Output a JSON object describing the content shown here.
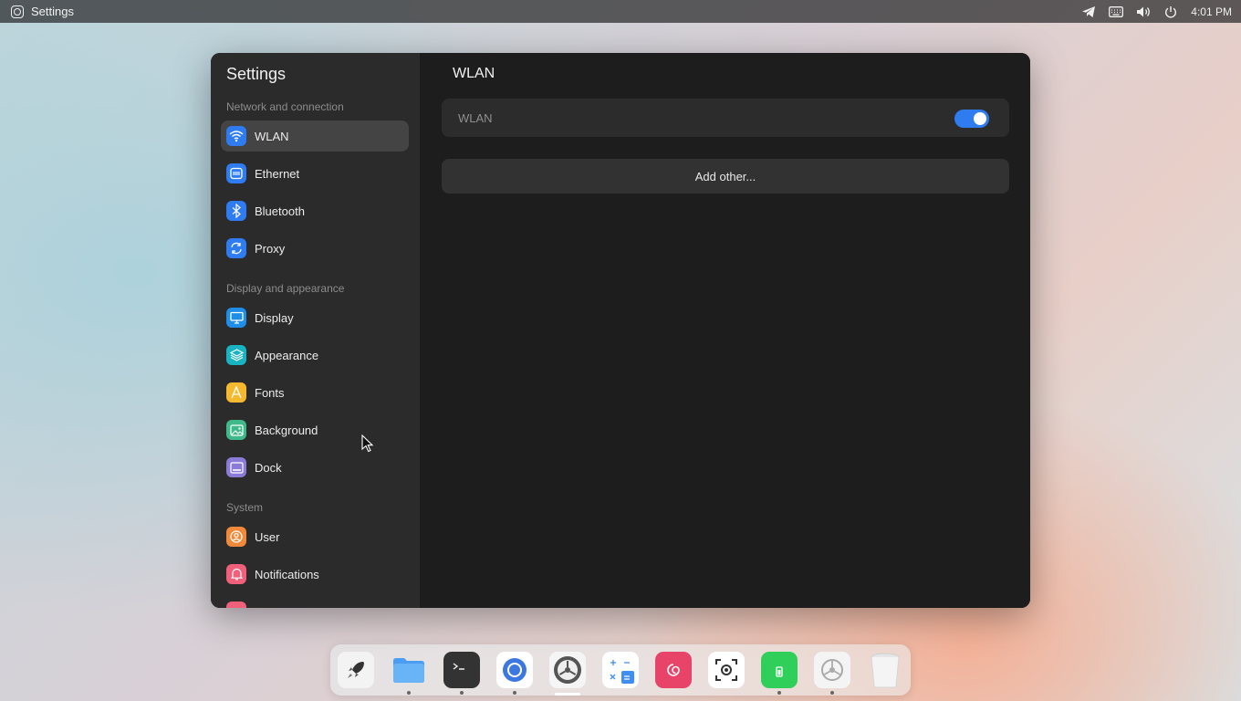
{
  "topbar": {
    "app_name": "Settings",
    "clock": "4:01 PM",
    "tray_icons": [
      "telegram-icon",
      "keyboard-icon",
      "volume-icon",
      "power-icon"
    ]
  },
  "sidebar": {
    "title": "Settings",
    "sections": [
      {
        "label": "Network and connection",
        "items": [
          {
            "label": "WLAN",
            "icon": "wifi-icon",
            "color": "#2f7cf0",
            "active": true
          },
          {
            "label": "Ethernet",
            "icon": "ethernet-icon",
            "color": "#2f7cf0"
          },
          {
            "label": "Bluetooth",
            "icon": "bluetooth-icon",
            "color": "#2f7cf0"
          },
          {
            "label": "Proxy",
            "icon": "proxy-icon",
            "color": "#2f7cf0"
          }
        ]
      },
      {
        "label": "Display and appearance",
        "items": [
          {
            "label": "Display",
            "icon": "monitor-icon",
            "color": "#1f8ee8"
          },
          {
            "label": "Appearance",
            "icon": "layers-icon",
            "color": "#18b4c4"
          },
          {
            "label": "Fonts",
            "icon": "font-icon",
            "color": "#f5b930"
          },
          {
            "label": "Background",
            "icon": "image-icon",
            "color": "#3fb98a"
          },
          {
            "label": "Dock",
            "icon": "dock-icon",
            "color": "#8b7ad8"
          }
        ]
      },
      {
        "label": "System",
        "items": [
          {
            "label": "User",
            "icon": "user-icon",
            "color": "#f0893a"
          },
          {
            "label": "Notifications",
            "icon": "bell-icon",
            "color": "#f0607a"
          }
        ]
      }
    ]
  },
  "main": {
    "title": "WLAN",
    "wlan_toggle": {
      "label": "WLAN",
      "on": true
    },
    "add_other_label": "Add other..."
  },
  "dock": {
    "apps": [
      {
        "name": "launcher",
        "icon": "rocket-icon",
        "running": false
      },
      {
        "name": "files",
        "icon": "folder-icon",
        "running": true
      },
      {
        "name": "terminal",
        "icon": "terminal-icon",
        "running": true
      },
      {
        "name": "browser",
        "icon": "browser-icon",
        "running": true
      },
      {
        "name": "settings",
        "icon": "settings-icon",
        "running": true,
        "active": true
      },
      {
        "name": "calculator",
        "icon": "calculator-icon",
        "running": false
      },
      {
        "name": "debian-app",
        "icon": "swirl-icon",
        "running": false
      },
      {
        "name": "screenshot",
        "icon": "screenshot-icon",
        "running": false
      },
      {
        "name": "battery-app",
        "icon": "battery-icon",
        "running": true
      },
      {
        "name": "system-settings",
        "icon": "gear-icon",
        "running": true
      },
      {
        "name": "trash",
        "icon": "trash-icon",
        "running": false
      }
    ]
  }
}
